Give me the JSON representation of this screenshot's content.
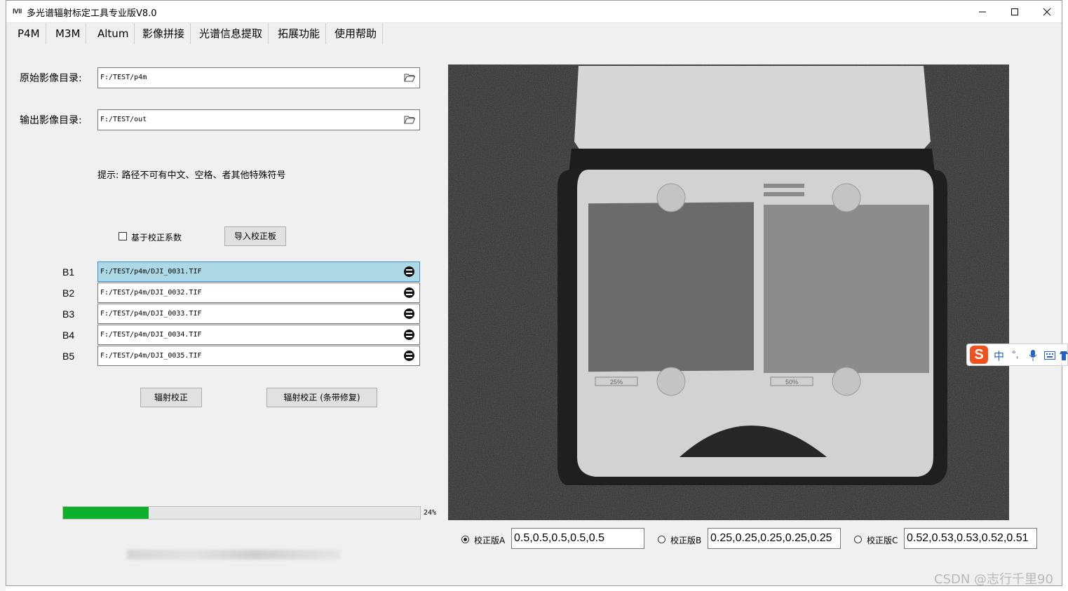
{
  "window": {
    "title": "多光谱辐射标定工具专业版V8.0",
    "icon_text": "ⅣII"
  },
  "menu": [
    "P4M",
    "M3M",
    "Altum",
    "影像拼接",
    "光谱信息提取",
    "拓展功能",
    "使用帮助"
  ],
  "inputs": {
    "source_label": "原始影像目录:",
    "source_value": "F:/TEST/p4m",
    "output_label": "输出影像目录:",
    "output_value": "F:/TEST/out"
  },
  "hint": "提示: 路径不可有中文、空格、者其他特殊符号",
  "calib_checkbox_label": "基于校正系数",
  "import_button": "导入校正板",
  "bands": [
    {
      "label": "B1",
      "path": "F:/TEST/p4m/DJI_0031.TIF"
    },
    {
      "label": "B2",
      "path": "F:/TEST/p4m/DJI_0032.TIF"
    },
    {
      "label": "B3",
      "path": "F:/TEST/p4m/DJI_0033.TIF"
    },
    {
      "label": "B4",
      "path": "F:/TEST/p4m/DJI_0034.TIF"
    },
    {
      "label": "B5",
      "path": "F:/TEST/p4m/DJI_0035.TIF"
    }
  ],
  "actions": {
    "radiometric": "辐射校正",
    "radiometric_stripe": "辐射校正 (条带修复)"
  },
  "progress": {
    "percent": 24,
    "text": "24%"
  },
  "preview": {
    "panel_left_label": "25%",
    "panel_right_label": "50%"
  },
  "plates": [
    {
      "label": "校正版A",
      "value": "0.5,0.5,0.5,0.5,0.5",
      "selected": true
    },
    {
      "label": "校正版B",
      "value": "0.25,0.25,0.25,0.25,0.25",
      "selected": false
    },
    {
      "label": "校正版C",
      "value": "0.52,0.53,0.53,0.52,0.51",
      "selected": false
    }
  ],
  "ime": {
    "logo": "S",
    "items": [
      "中",
      "°,"
    ]
  },
  "watermark": "CSDN @志行千里90",
  "colors": {
    "progress_fill": "#0db02b",
    "selected_field": "#add8e6",
    "accent": "#3d8fd6"
  }
}
